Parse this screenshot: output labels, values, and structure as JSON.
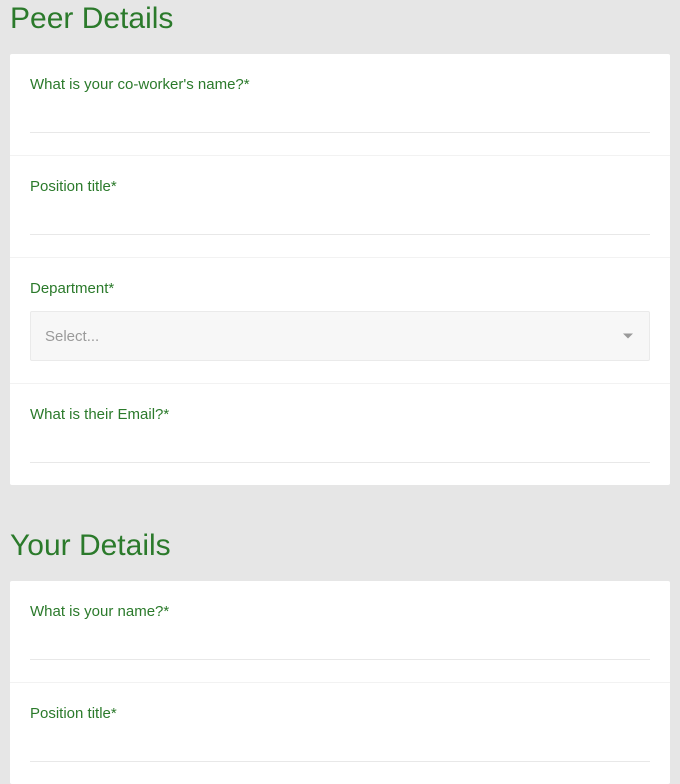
{
  "peer": {
    "title": "Peer Details",
    "fields": {
      "coworker_name": {
        "label": "What is your co-worker's name?*",
        "value": ""
      },
      "position_title": {
        "label": "Position title*",
        "value": ""
      },
      "department": {
        "label": "Department*",
        "placeholder": "Select..."
      },
      "email": {
        "label": "What is their Email?*",
        "value": ""
      }
    }
  },
  "your": {
    "title": "Your Details",
    "fields": {
      "your_name": {
        "label": "What is your name?*",
        "value": ""
      },
      "position_title": {
        "label": "Position title*",
        "value": ""
      }
    }
  }
}
